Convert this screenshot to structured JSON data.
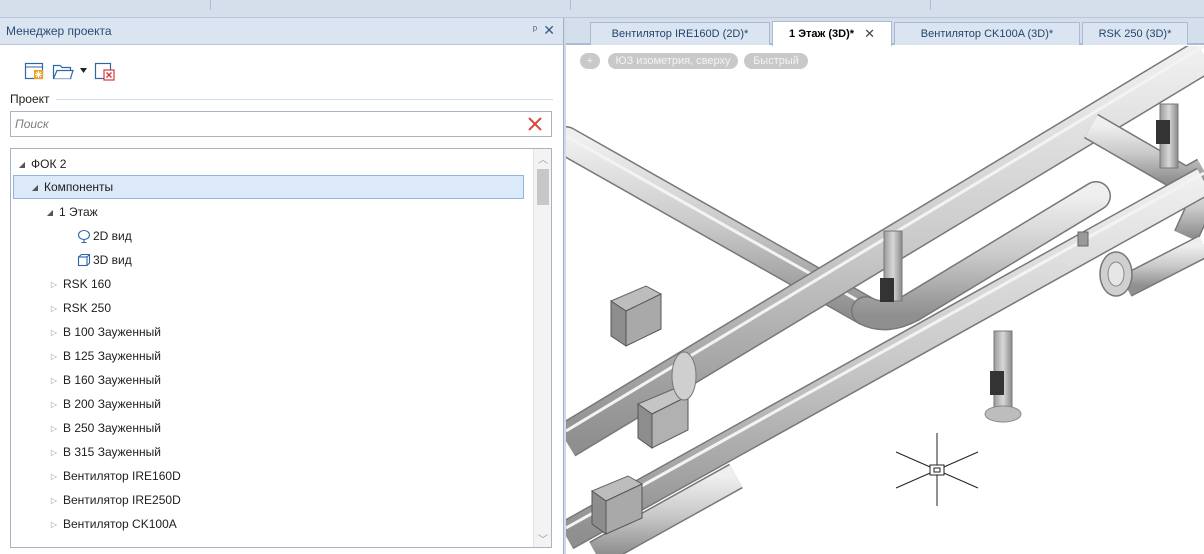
{
  "panel": {
    "title": "Менеджер проекта",
    "pin_glyph": "ᵖ",
    "close_glyph": "✕"
  },
  "toolbar": {
    "icons": [
      "new-project-icon",
      "open-folder-icon",
      "dropdown-arrow-icon",
      "close-project-icon"
    ]
  },
  "project": {
    "label": "Проект"
  },
  "search": {
    "placeholder": "Поиск",
    "value": ""
  },
  "tree": {
    "items": [
      {
        "label": "ФОК 2",
        "expander": "◢"
      },
      {
        "label": "Компоненты",
        "expander": "◢"
      },
      {
        "label": "1 Этаж",
        "expander": "◢"
      },
      {
        "label": "2D вид",
        "icon": "2d-view-icon"
      },
      {
        "label": "3D вид",
        "icon": "3d-view-icon"
      },
      {
        "label": "RSK 160",
        "expander": "▷"
      },
      {
        "label": "RSK 250",
        "expander": "▷"
      },
      {
        "label": "В 100 Зауженный",
        "expander": "▷"
      },
      {
        "label": "В 125 Зауженный",
        "expander": "▷"
      },
      {
        "label": "В 160 Зауженный",
        "expander": "▷"
      },
      {
        "label": "В 200 Зауженный",
        "expander": "▷"
      },
      {
        "label": "В 250 Зауженный",
        "expander": "▷"
      },
      {
        "label": "В 315 Зауженный",
        "expander": "▷"
      },
      {
        "label": "Вентилятор IRE160D",
        "expander": "▷"
      },
      {
        "label": "Вентилятор IRE250D",
        "expander": "▷"
      },
      {
        "label": "Вентилятор CK100A",
        "expander": "▷"
      }
    ],
    "selected_index": 1
  },
  "tabs": [
    {
      "label": "Вентилятор IRE160D (2D)*",
      "active": false
    },
    {
      "label": "1 Этаж (3D)*",
      "active": true,
      "close_glyph": "✕"
    },
    {
      "label": "Вентилятор CK100A (3D)*",
      "active": false
    },
    {
      "label": "RSK 250 (3D)*",
      "active": false
    }
  ],
  "viewport": {
    "controls": [
      "+",
      "ЮЗ изометрия, сверху",
      "Быстрый"
    ]
  },
  "colors": {
    "accent": "#2b4a73",
    "selection": "#dce9f8",
    "panel_header": "#dbe5f1",
    "pipe": "#c4c4c4"
  }
}
